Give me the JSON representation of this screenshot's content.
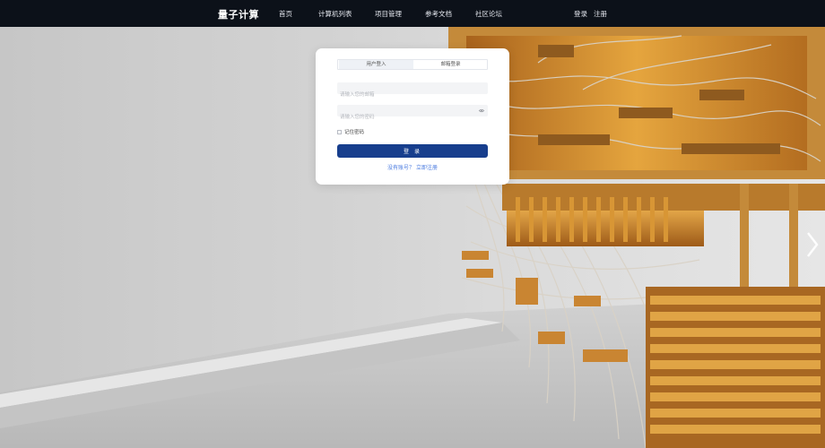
{
  "header": {
    "brand": "量子计算",
    "nav": [
      "首页",
      "计算机列表",
      "项目管理",
      "参考文档",
      "社区论坛"
    ],
    "login": "登录",
    "register": "注册"
  },
  "login_card": {
    "tabs": [
      "用户登入",
      "邮箱登录"
    ],
    "username_placeholder": "请输入您的邮箱",
    "password_placeholder": "请输入您的密码",
    "remember_label": "记住密码",
    "submit_label": "登 录",
    "register_prompt": "没有账号？ 立即注册"
  },
  "colors": {
    "header_bg": "#0c1119",
    "primary": "#173e8d",
    "link": "#4a7be0"
  },
  "icons": {
    "password_toggle": "eye-icon",
    "carousel_next": "chevron-right-icon"
  }
}
